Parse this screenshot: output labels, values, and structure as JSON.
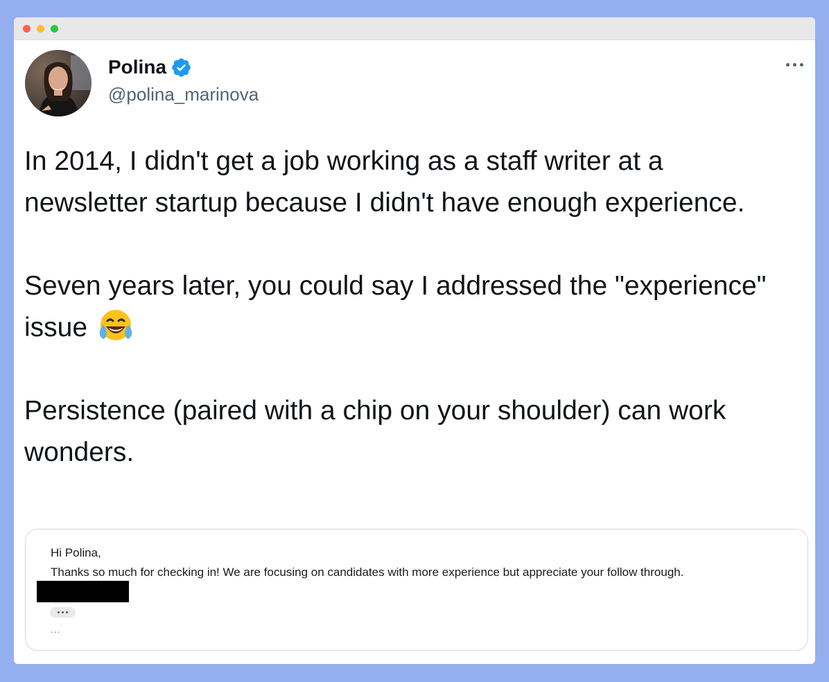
{
  "tweet": {
    "display_name": "Polina",
    "handle": "@polina_marinova",
    "verified": true,
    "paragraphs": [
      "In 2014, I didn't get a job working as a staff writer at a newsletter startup because I didn't have enough experience.",
      "Seven years later, you could say I addressed the \"experience\" issue",
      "Persistence (paired with a chip on your shoulder) can work wonders."
    ],
    "emoji_after_paragraph_2": "face-with-tears-of-joy"
  },
  "email_image": {
    "greeting": "Hi Polina,",
    "body": "Thanks so much for checking in! We are focusing on candidates with more experience but appreciate your follow through.",
    "trailing": "..."
  },
  "colors": {
    "background": "#94aff0",
    "verified_badge": "#1d9bf0",
    "text": "#0f1419",
    "secondary_text": "#536471"
  }
}
